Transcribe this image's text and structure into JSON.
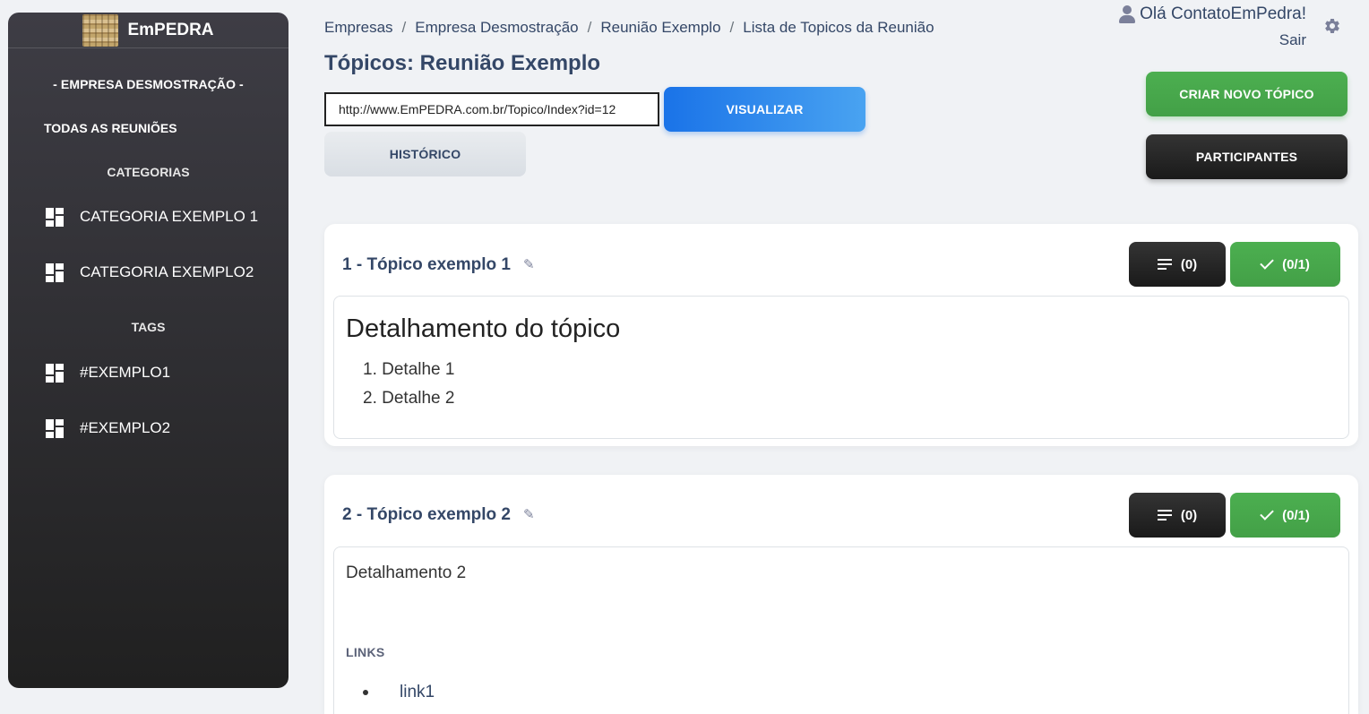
{
  "sidebar": {
    "brand": "EmPEDRA",
    "company": "- EMPRESA DESMOSTRAÇÃO -",
    "all_meetings": "TODAS AS REUNIÕES",
    "categories_title": "CATEGORIAS",
    "categories": [
      {
        "label": "CATEGORIA EXEMPLO 1",
        "icon": "dashboard-icon"
      },
      {
        "label": "CATEGORIA EXEMPLO2",
        "icon": "dashboard-icon"
      }
    ],
    "tags_title": "TAGS",
    "tags": [
      {
        "label": "#EXEMPLO1",
        "icon": "dashboard-icon"
      },
      {
        "label": "#EXEMPLO2",
        "icon": "dashboard-icon"
      }
    ]
  },
  "breadcrumb": {
    "items": [
      "Empresas",
      "Empresa Desmostração",
      "Reunião Exemplo",
      "Lista de Topicos da Reunião"
    ],
    "separator": "/"
  },
  "header": {
    "title": "Tópicos: Reunião Exemplo",
    "greeting": "Olá ContatoEmPedra!",
    "logout": "Sair"
  },
  "toolbar": {
    "url_value": "http://www.EmPEDRA.com.br/Topico/Index?id=12",
    "view_label": "VISUALIZAR",
    "history_label": "HISTÓRICO",
    "create_label": "CRIAR NOVO TÓPICO",
    "participants_label": "PARTICIPANTES"
  },
  "topics": [
    {
      "title": "1 - Tópico exemplo 1",
      "comments_count": "(0)",
      "tasks_count": "(0/1)",
      "heading": "Detalhamento do tópico",
      "details": [
        "1. Detalhe 1",
        "2. Detalhe 2"
      ]
    },
    {
      "title": "2 - Tópico exemplo 2",
      "comments_count": "(0)",
      "tasks_count": "(0/1)",
      "text": "Detalhamento 2",
      "links_label": "LINKS",
      "links": [
        "link1"
      ]
    }
  ],
  "colors": {
    "primary": "#1a73e8",
    "success": "#4caf50",
    "dark": "#1a1a1a",
    "text": "#344767",
    "background": "#f0f2f5"
  }
}
